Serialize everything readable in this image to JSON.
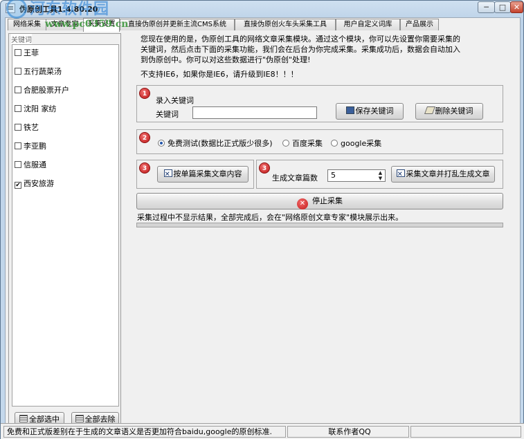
{
  "window": {
    "title": "伪原创工具1.4.80.20",
    "controls": {
      "minimize": "─",
      "maximize": "□",
      "close": "✕"
    }
  },
  "watermark": {
    "text": "河东软件园",
    "url": "www.pc0359.cn"
  },
  "tabs": [
    {
      "label": "网络采集"
    },
    {
      "label": "文章专家"
    },
    {
      "label": "采集设置"
    },
    {
      "label": "直接伪原创并更新主流CMS系统"
    },
    {
      "label": "直接伪原创火车头采集工具"
    },
    {
      "label": "用户自定义词库"
    },
    {
      "label": "产品展示"
    }
  ],
  "sidebar": {
    "group_label": "关键词",
    "keywords": [
      {
        "label": "王菲",
        "checked": false
      },
      {
        "label": "五行蔬菜汤",
        "checked": false
      },
      {
        "label": "合肥股票开户",
        "checked": false
      },
      {
        "label": "沈阳 家纺",
        "checked": false
      },
      {
        "label": "铁艺",
        "checked": false
      },
      {
        "label": "李亚鹏",
        "checked": false
      },
      {
        "label": "信服通",
        "checked": false
      },
      {
        "label": "西安旅游",
        "checked": true
      }
    ],
    "select_all": "全部选中",
    "clear_all": "全部去除"
  },
  "info": {
    "line1": "您现在使用的是，伪原创工具的网络文章采集模块。通过这个模块，你可以先设置你需要采集的",
    "line2": "关键词，然后点击下面的采集功能，我们会在后台为你完成采集。采集成功后，数据会自动加入",
    "line3": "到伪原创中。你可以对这些数据进行\"伪原创\"处理!",
    "line4": "不支持IE6，如果你是IE6，请升级到IE8！！！"
  },
  "step1": {
    "badge": "1",
    "title": "录入关键词",
    "field_label": "关键词",
    "field_value": "",
    "save_button": "保存关键词",
    "delete_button": "删除关键词"
  },
  "step2": {
    "badge": "2",
    "options": [
      {
        "label": "免费测试(数据比正式版少很多)",
        "selected": true
      },
      {
        "label": "百度采集",
        "selected": false
      },
      {
        "label": "google采集",
        "selected": false
      }
    ]
  },
  "step3a": {
    "badge": "3",
    "button": "按单篇采集文章内容"
  },
  "step3b": {
    "badge": "3",
    "count_label": "生成文章篇数",
    "count_value": "5",
    "button": "采集文章并打乱生成文章"
  },
  "stop_button": "停止采集",
  "process_note": "采集过程中不显示结果，全部完成后，会在\"网络原创文章专家\"模块展示出来。",
  "progress": {
    "fraction": 0.0
  },
  "statusbar": {
    "message": "免费和正式版差别在于生成的文章语义是否更加符合baidu,google的原创标准.",
    "contact": "联系作者QQ",
    "extra": ""
  },
  "colors": {
    "window_frame": "#c4d8ec",
    "badge_red": "#c01818",
    "stop_red": "#c41a1a",
    "watermark_blue": "#1e78d2",
    "watermark_green": "#3c963c"
  }
}
